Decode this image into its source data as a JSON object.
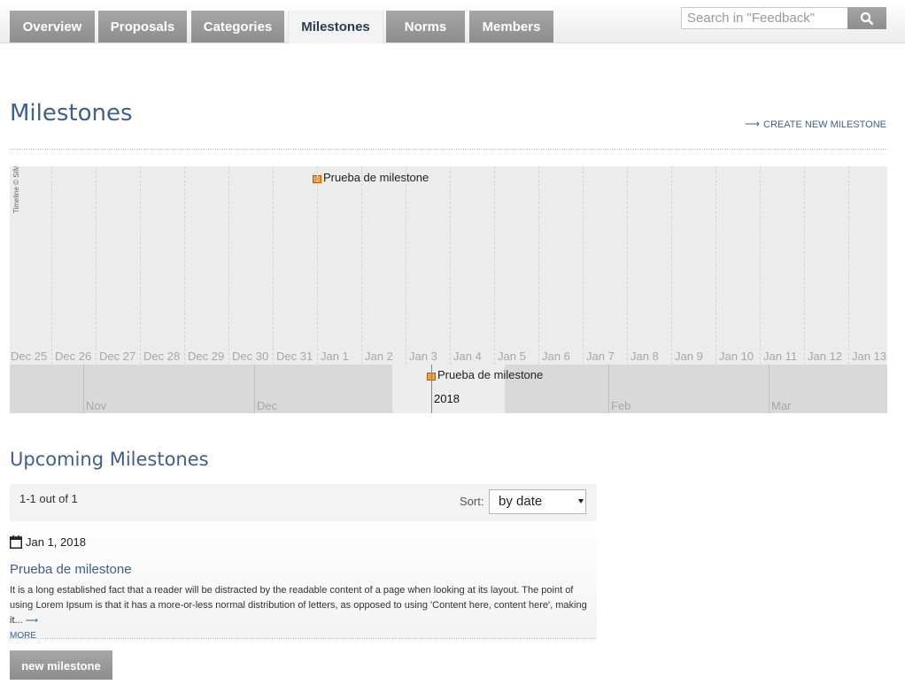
{
  "nav": {
    "tabs": [
      {
        "label": "Overview",
        "active": false
      },
      {
        "label": "Proposals",
        "active": false
      },
      {
        "label": "Categories",
        "active": false
      },
      {
        "label": "Milestones",
        "active": true
      },
      {
        "label": "Norms",
        "active": false
      },
      {
        "label": "Members",
        "active": false
      }
    ],
    "search_placeholder": "Search in \"Feedback\"",
    "search_icon": "search-icon"
  },
  "page": {
    "title": "Milestones",
    "create_link": "CREATE NEW MILESTONE"
  },
  "timeline": {
    "day_labels": [
      "Dec 25",
      "Dec 26",
      "Dec 27",
      "Dec 28",
      "Dec 29",
      "Dec 30",
      "Dec 31",
      "Jan 1",
      "Jan 2",
      "Jan 3",
      "Jan 4",
      "Jan 5",
      "Jan 6",
      "Jan 7",
      "Jan 8",
      "Jan 9",
      "Jan 10",
      "Jan 11",
      "Jan 12",
      "Jan 13"
    ],
    "month_labels": [
      "Nov",
      "Dec",
      "2018",
      "Feb",
      "Mar"
    ],
    "event_label": "Prueba de milestone",
    "event_date": "Jan 1",
    "credit": "Timeline © SIMILE"
  },
  "upcoming": {
    "title": "Upcoming Milestones",
    "count": "1-1 out of 1",
    "sort_label": "Sort:",
    "sort_value": "by date",
    "items": [
      {
        "date": "Jan 1, 2018",
        "title": "Prueba de milestone",
        "description": "It is a long established fact that a reader will be distracted by the readable content of a page when looking at its layout. The point of using Lorem Ipsum is that it has a more-or-less normal distribution of letters, as opposed to using 'Content here, content here', making it...",
        "more_label": "MORE"
      }
    ],
    "new_button": "new milestone"
  },
  "colors": {
    "accent": "#3e6090",
    "tab_bg": "#9a9a9a",
    "timeline_bg": "#ececec"
  }
}
